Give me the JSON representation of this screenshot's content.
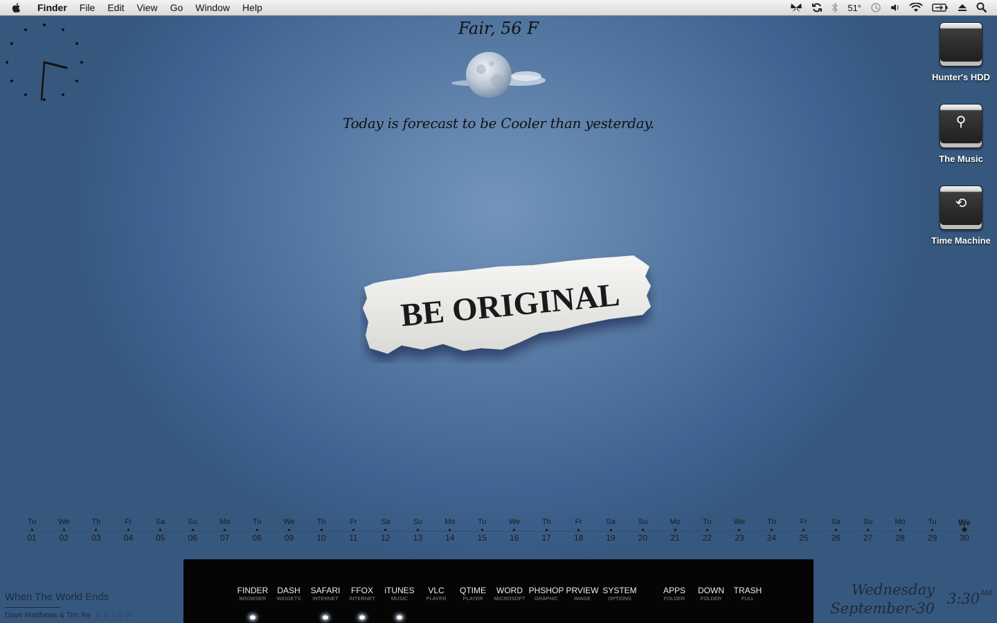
{
  "menubar": {
    "app_name": "Finder",
    "items": [
      "File",
      "Edit",
      "View",
      "Go",
      "Window",
      "Help"
    ],
    "temperature": "51°",
    "status_icons": [
      "butterfly-icon",
      "sync-icon",
      "bluetooth-icon",
      "temperature",
      "time-machine-icon",
      "volume-icon",
      "wifi-icon",
      "battery-icon",
      "eject-icon",
      "spotlight-icon"
    ]
  },
  "weather": {
    "condition": "Fair, 56 F",
    "forecast": "Today is forecast to be Cooler than yesterday."
  },
  "wallpaper": {
    "text": "BE ORIGINAL"
  },
  "drives": [
    {
      "label": "Hunter's HDD",
      "icon": "apple-drive-icon",
      "symbol": ""
    },
    {
      "label": "The Music",
      "icon": "firewire-drive-icon",
      "symbol": "⚲"
    },
    {
      "label": "Time Machine",
      "icon": "time-machine-drive-icon",
      "symbol": "⟲"
    }
  ],
  "calendar": {
    "days": [
      {
        "w": "Tu",
        "d": "01"
      },
      {
        "w": "We",
        "d": "02"
      },
      {
        "w": "Th",
        "d": "03"
      },
      {
        "w": "Fr",
        "d": "04"
      },
      {
        "w": "Sa",
        "d": "05"
      },
      {
        "w": "Su",
        "d": "06"
      },
      {
        "w": "Mo",
        "d": "07"
      },
      {
        "w": "Tu",
        "d": "08"
      },
      {
        "w": "We",
        "d": "09"
      },
      {
        "w": "Th",
        "d": "10"
      },
      {
        "w": "Fr",
        "d": "11"
      },
      {
        "w": "Sa",
        "d": "12"
      },
      {
        "w": "Su",
        "d": "13"
      },
      {
        "w": "Mo",
        "d": "14"
      },
      {
        "w": "Tu",
        "d": "15"
      },
      {
        "w": "We",
        "d": "16"
      },
      {
        "w": "Th",
        "d": "17"
      },
      {
        "w": "Fr",
        "d": "18"
      },
      {
        "w": "Sa",
        "d": "19"
      },
      {
        "w": "Su",
        "d": "20"
      },
      {
        "w": "Mo",
        "d": "21"
      },
      {
        "w": "Tu",
        "d": "22"
      },
      {
        "w": "We",
        "d": "23"
      },
      {
        "w": "Th",
        "d": "24"
      },
      {
        "w": "Fr",
        "d": "25"
      },
      {
        "w": "Sa",
        "d": "26"
      },
      {
        "w": "Su",
        "d": "27"
      },
      {
        "w": "Mo",
        "d": "28"
      },
      {
        "w": "Tu",
        "d": "29"
      },
      {
        "w": "We",
        "d": "30"
      }
    ],
    "today": "30"
  },
  "now_playing": {
    "title": "When The World Ends",
    "artist": "Dave Matthews & Tim Re",
    "rating": "☆☆☆☆☆"
  },
  "dock": {
    "items": [
      {
        "name": "FINDER",
        "sub": "BROWSER",
        "running": true
      },
      {
        "name": "DASH",
        "sub": "WIDGETS",
        "running": false
      },
      {
        "name": "SAFARI",
        "sub": "INTERNET",
        "running": true
      },
      {
        "name": "FFOX",
        "sub": "INTERNET",
        "running": true
      },
      {
        "name": "iTUNES",
        "sub": "MUSIC",
        "running": true
      },
      {
        "name": "VLC",
        "sub": "PLAYER",
        "running": false
      },
      {
        "name": "QTIME",
        "sub": "PLAYER",
        "running": false
      },
      {
        "name": "WORD",
        "sub": "MICROSOFT",
        "running": false
      },
      {
        "name": "PHSHOP",
        "sub": "GRAPHIC",
        "running": false
      },
      {
        "name": "PRVIEW",
        "sub": "IMAGE",
        "running": false
      },
      {
        "name": "SYSTEM",
        "sub": "OPTIONS",
        "running": false
      },
      {
        "name": "APPS",
        "sub": "FOLDER",
        "running": false
      },
      {
        "name": "DOWN",
        "sub": "FOLDER",
        "running": false
      },
      {
        "name": "TRASH",
        "sub": "FULL",
        "running": false
      }
    ]
  },
  "datetime": {
    "weekday": "Wednesday",
    "date": "September-30",
    "time": "3:30",
    "ampm": "AM"
  }
}
